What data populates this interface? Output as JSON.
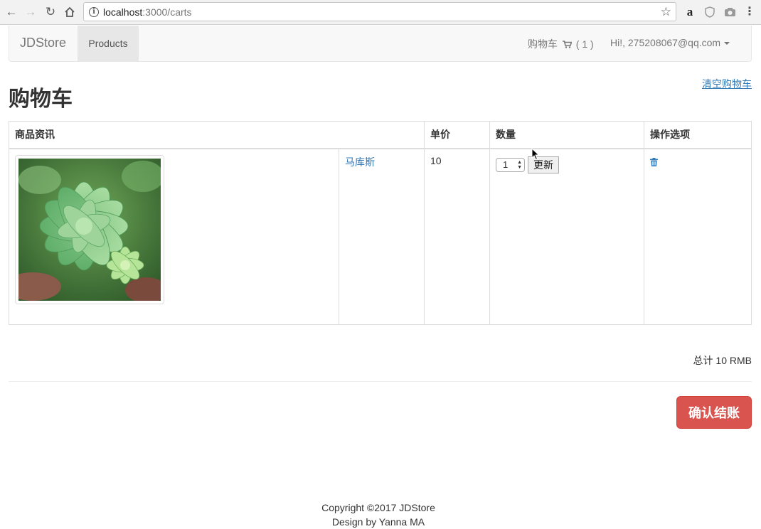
{
  "browser": {
    "url_host": "localhost",
    "url_path": ":3000/carts"
  },
  "navbar": {
    "brand": "JDStore",
    "products": "Products",
    "cart_label": "购物车",
    "cart_count": "( 1 )",
    "user": "Hi!, 275208067@qq.com"
  },
  "page": {
    "clear_cart": "清空购物车",
    "title": "购物车"
  },
  "table": {
    "headers": [
      "商品资讯",
      "单价",
      "数量",
      "操作选项"
    ],
    "rows": [
      {
        "name": "马库斯",
        "price": "10",
        "quantity": "1",
        "update_label": "更新"
      }
    ]
  },
  "summary": {
    "total": "总计 10 RMB",
    "checkout": "确认结账"
  },
  "footer": {
    "copyright": "Copyright ©2017 JDStore",
    "design": "Design by Yanna MA"
  },
  "colors": {
    "link": "#337ab7",
    "checkout": "#d9534f"
  }
}
